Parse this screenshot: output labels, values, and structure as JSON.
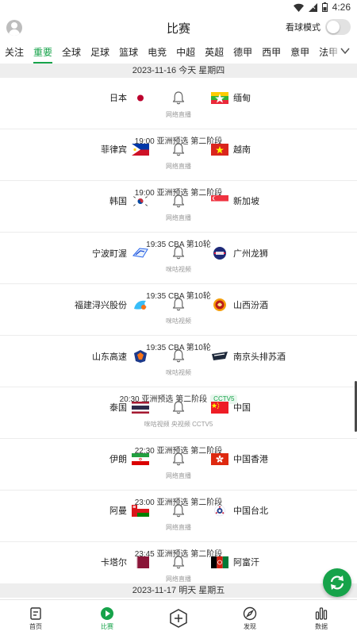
{
  "status_bar": {
    "time": "4:26"
  },
  "header": {
    "title": "比赛",
    "watch_mode_label": "看球模式"
  },
  "tabs": [
    {
      "label": "关注"
    },
    {
      "label": "重要"
    },
    {
      "label": "全球"
    },
    {
      "label": "足球"
    },
    {
      "label": "篮球"
    },
    {
      "label": "电竞"
    },
    {
      "label": "中超"
    },
    {
      "label": "英超"
    },
    {
      "label": "德甲"
    },
    {
      "label": "西甲"
    },
    {
      "label": "意甲"
    },
    {
      "label": "法甲"
    }
  ],
  "active_tab": "重要",
  "dates": [
    {
      "label": "2023-11-16 今天 星期四"
    },
    {
      "label": "2023-11-17 明天 星期五"
    }
  ],
  "matches": [
    {
      "meta": "",
      "channel_tag": "",
      "home": "日本",
      "away": "缅甸",
      "broadcast": "网络直播",
      "home_flag": "japan",
      "away_flag": "myanmar"
    },
    {
      "meta": "19:00 亚洲预选 第二阶段",
      "channel_tag": "",
      "home": "菲律宾",
      "away": "越南",
      "broadcast": "网络直播",
      "home_flag": "philippines",
      "away_flag": "vietnam"
    },
    {
      "meta": "19:00 亚洲预选 第二阶段",
      "channel_tag": "",
      "home": "韩国",
      "away": "新加坡",
      "broadcast": "网络直播",
      "home_flag": "korea",
      "away_flag": "singapore"
    },
    {
      "meta": "19:35 CBA 第10轮",
      "channel_tag": "",
      "home": "宁波町渥",
      "away": "广州龙狮",
      "broadcast": "咪咕视频",
      "home_flag": "ningbo-logo",
      "away_flag": "guangzhou-logo"
    },
    {
      "meta": "19:35 CBA 第10轮",
      "channel_tag": "",
      "home": "福建浔兴股份",
      "away": "山西汾酒",
      "broadcast": "咪咕视频",
      "home_flag": "fujian-logo",
      "away_flag": "shanxi-logo"
    },
    {
      "meta": "19:35 CBA 第10轮",
      "channel_tag": "",
      "home": "山东高速",
      "away": "南京头排苏酒",
      "broadcast": "咪咕视频",
      "home_flag": "shandong-logo",
      "away_flag": "nanjing-logo"
    },
    {
      "meta": "20:30 亚洲预选 第二阶段",
      "channel_tag": "CCTV5",
      "home": "泰国",
      "away": "中国",
      "broadcast": "咪咕视频 央视频 CCTV5",
      "home_flag": "thailand",
      "away_flag": "china"
    },
    {
      "meta": "22:30 亚洲预选 第二阶段",
      "channel_tag": "",
      "home": "伊朗",
      "away": "中国香港",
      "broadcast": "网络直播",
      "home_flag": "iran",
      "away_flag": "hongkong"
    },
    {
      "meta": "23:00 亚洲预选 第二阶段",
      "channel_tag": "",
      "home": "阿曼",
      "away": "中国台北",
      "broadcast": "网络直播",
      "home_flag": "oman",
      "away_flag": "chinese-taipei"
    },
    {
      "meta": "23:45 亚洲预选 第二阶段",
      "channel_tag": "",
      "home": "卡塔尔",
      "away": "阿富汗",
      "broadcast": "网络直播",
      "home_flag": "qatar",
      "away_flag": "afghanistan"
    }
  ],
  "bottom_nav": [
    {
      "label": "首页",
      "icon": "home-icon"
    },
    {
      "label": "比赛",
      "icon": "play-icon"
    },
    {
      "label": "",
      "icon": "plus-icon"
    },
    {
      "label": "发现",
      "icon": "discover-icon"
    },
    {
      "label": "数据",
      "icon": "data-icon"
    }
  ],
  "colors": {
    "accent": "#16a34a",
    "date_bar": "#eeeeee"
  }
}
